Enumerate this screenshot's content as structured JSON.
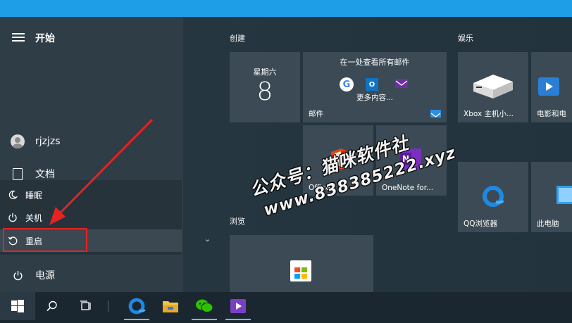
{
  "start_menu": {
    "title": "开始",
    "user_name": "rjzjzs",
    "documents_label": "文档",
    "power_label": "电源",
    "power_menu": [
      {
        "label": "睡眠",
        "icon": "moon-icon"
      },
      {
        "label": "关机",
        "icon": "power-icon"
      },
      {
        "label": "重启",
        "icon": "restart-icon"
      }
    ]
  },
  "groups": {
    "create": "创建",
    "entertainment": "娱乐",
    "browse": "浏览"
  },
  "tiles": {
    "calendar": {
      "day_name": "星期六",
      "day_number": "8"
    },
    "mail": {
      "header": "在一处查看所有邮件",
      "more": "更多内容...",
      "label": "邮件"
    },
    "office": {
      "label": "Office"
    },
    "onenote": {
      "label": "OneNote for..."
    },
    "xbox": {
      "label": "Xbox 主机小..."
    },
    "movies": {
      "label": "电影和电"
    },
    "qq_browser": {
      "label": "QQ浏览器"
    },
    "this_pc": {
      "label": "此电脑"
    },
    "store": {
      "label": ""
    }
  },
  "watermark": {
    "line1": "公众号：猫咪软件社",
    "line2": "www.838385222.xyz"
  },
  "colors": {
    "accent": "#1e9ee6",
    "highlight_box": "#e62222",
    "arrow": "#e62222"
  },
  "taskbar": {
    "icons": [
      "windows-start-icon",
      "search-icon",
      "task-view-icon",
      "qq-browser-icon",
      "file-explorer-icon",
      "wechat-icon",
      "video-player-icon"
    ]
  }
}
